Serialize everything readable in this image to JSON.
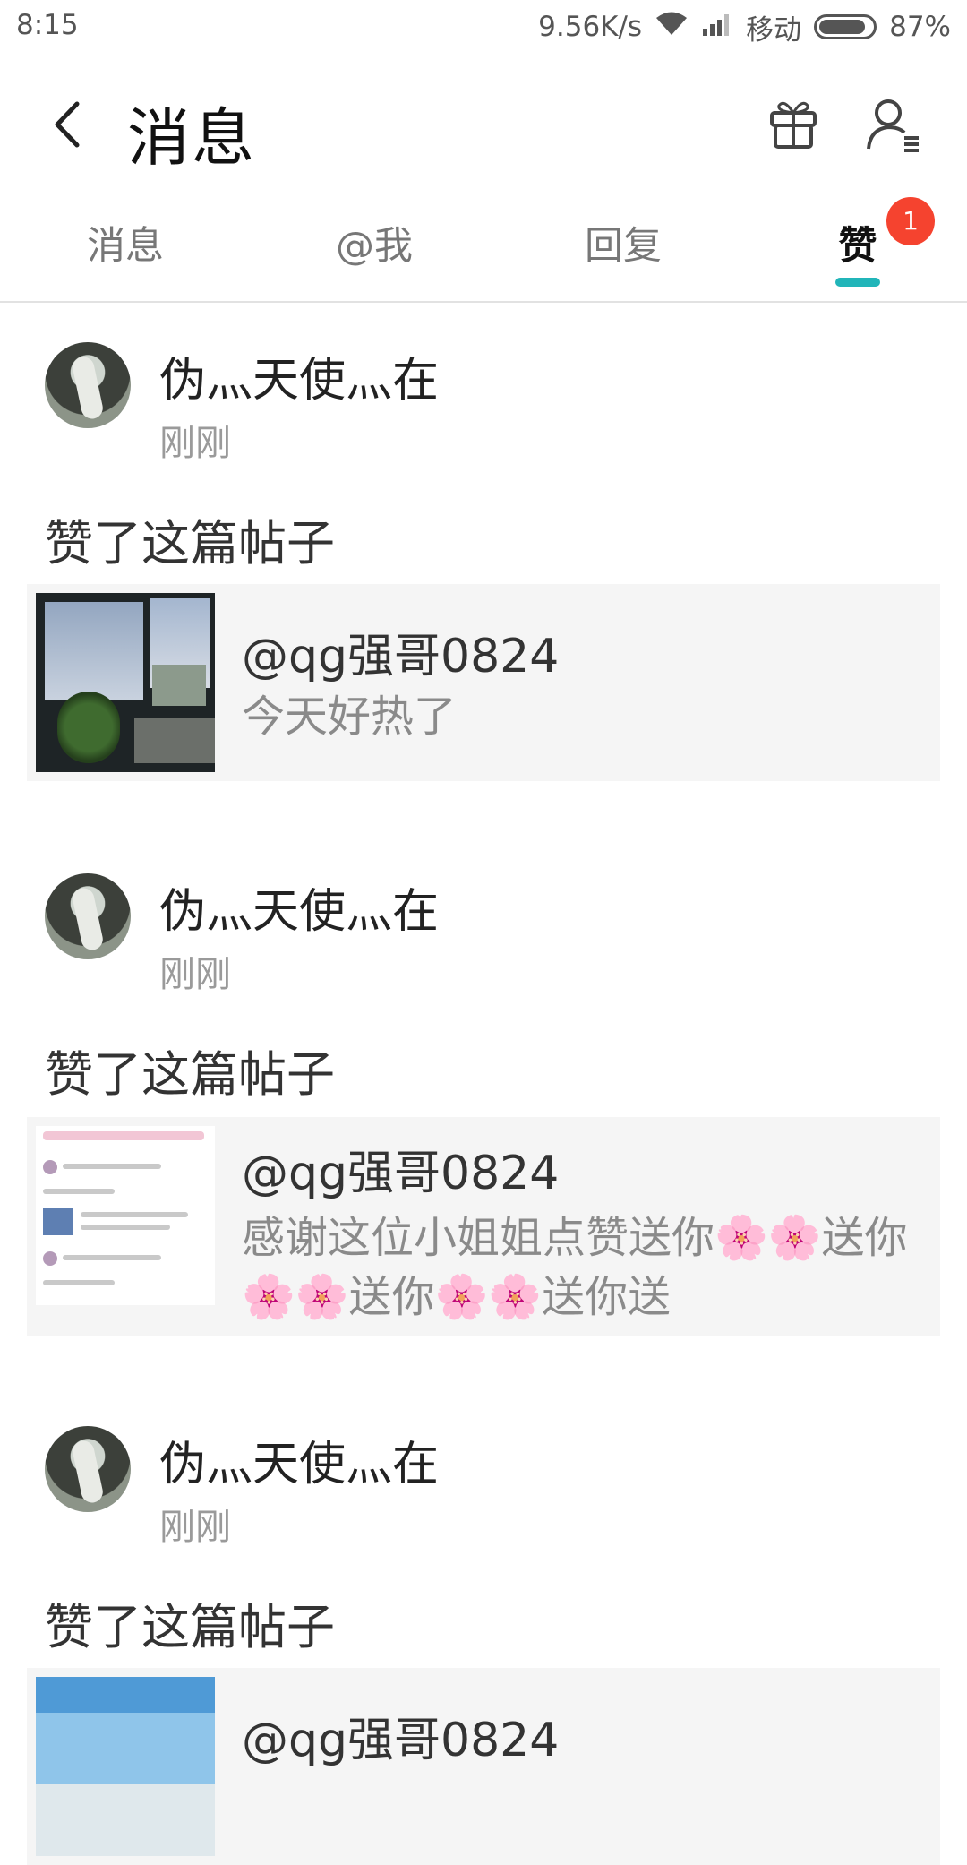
{
  "status_bar": {
    "time": "8:15",
    "speed": "9.56K/s",
    "carrier": "移动",
    "battery": "87%",
    "battery_level": 0.87
  },
  "header": {
    "title": "消息"
  },
  "tabs": [
    {
      "label": "消息",
      "active": false
    },
    {
      "label": "@我",
      "active": false
    },
    {
      "label": "回复",
      "active": false
    },
    {
      "label": "赞",
      "active": true,
      "badge": "1"
    }
  ],
  "accent_color": "#21b5b9",
  "badge_color": "#f5432f",
  "items": [
    {
      "user": "伪灬天使灬在",
      "time": "刚刚",
      "action": "赞了这篇帖子",
      "post_author": "@qg强哥0824",
      "post_text": "今天好热了"
    },
    {
      "user": "伪灬天使灬在",
      "time": "刚刚",
      "action": "赞了这篇帖子",
      "post_author": "@qg强哥0824",
      "post_text": "感谢这位小姐姐点赞送你🌸🌸送你🌸🌸送你🌸🌸送你送"
    },
    {
      "user": "伪灬天使灬在",
      "time": "刚刚",
      "action": "赞了这篇帖子",
      "post_author": "@qg强哥0824",
      "post_text": ""
    }
  ]
}
